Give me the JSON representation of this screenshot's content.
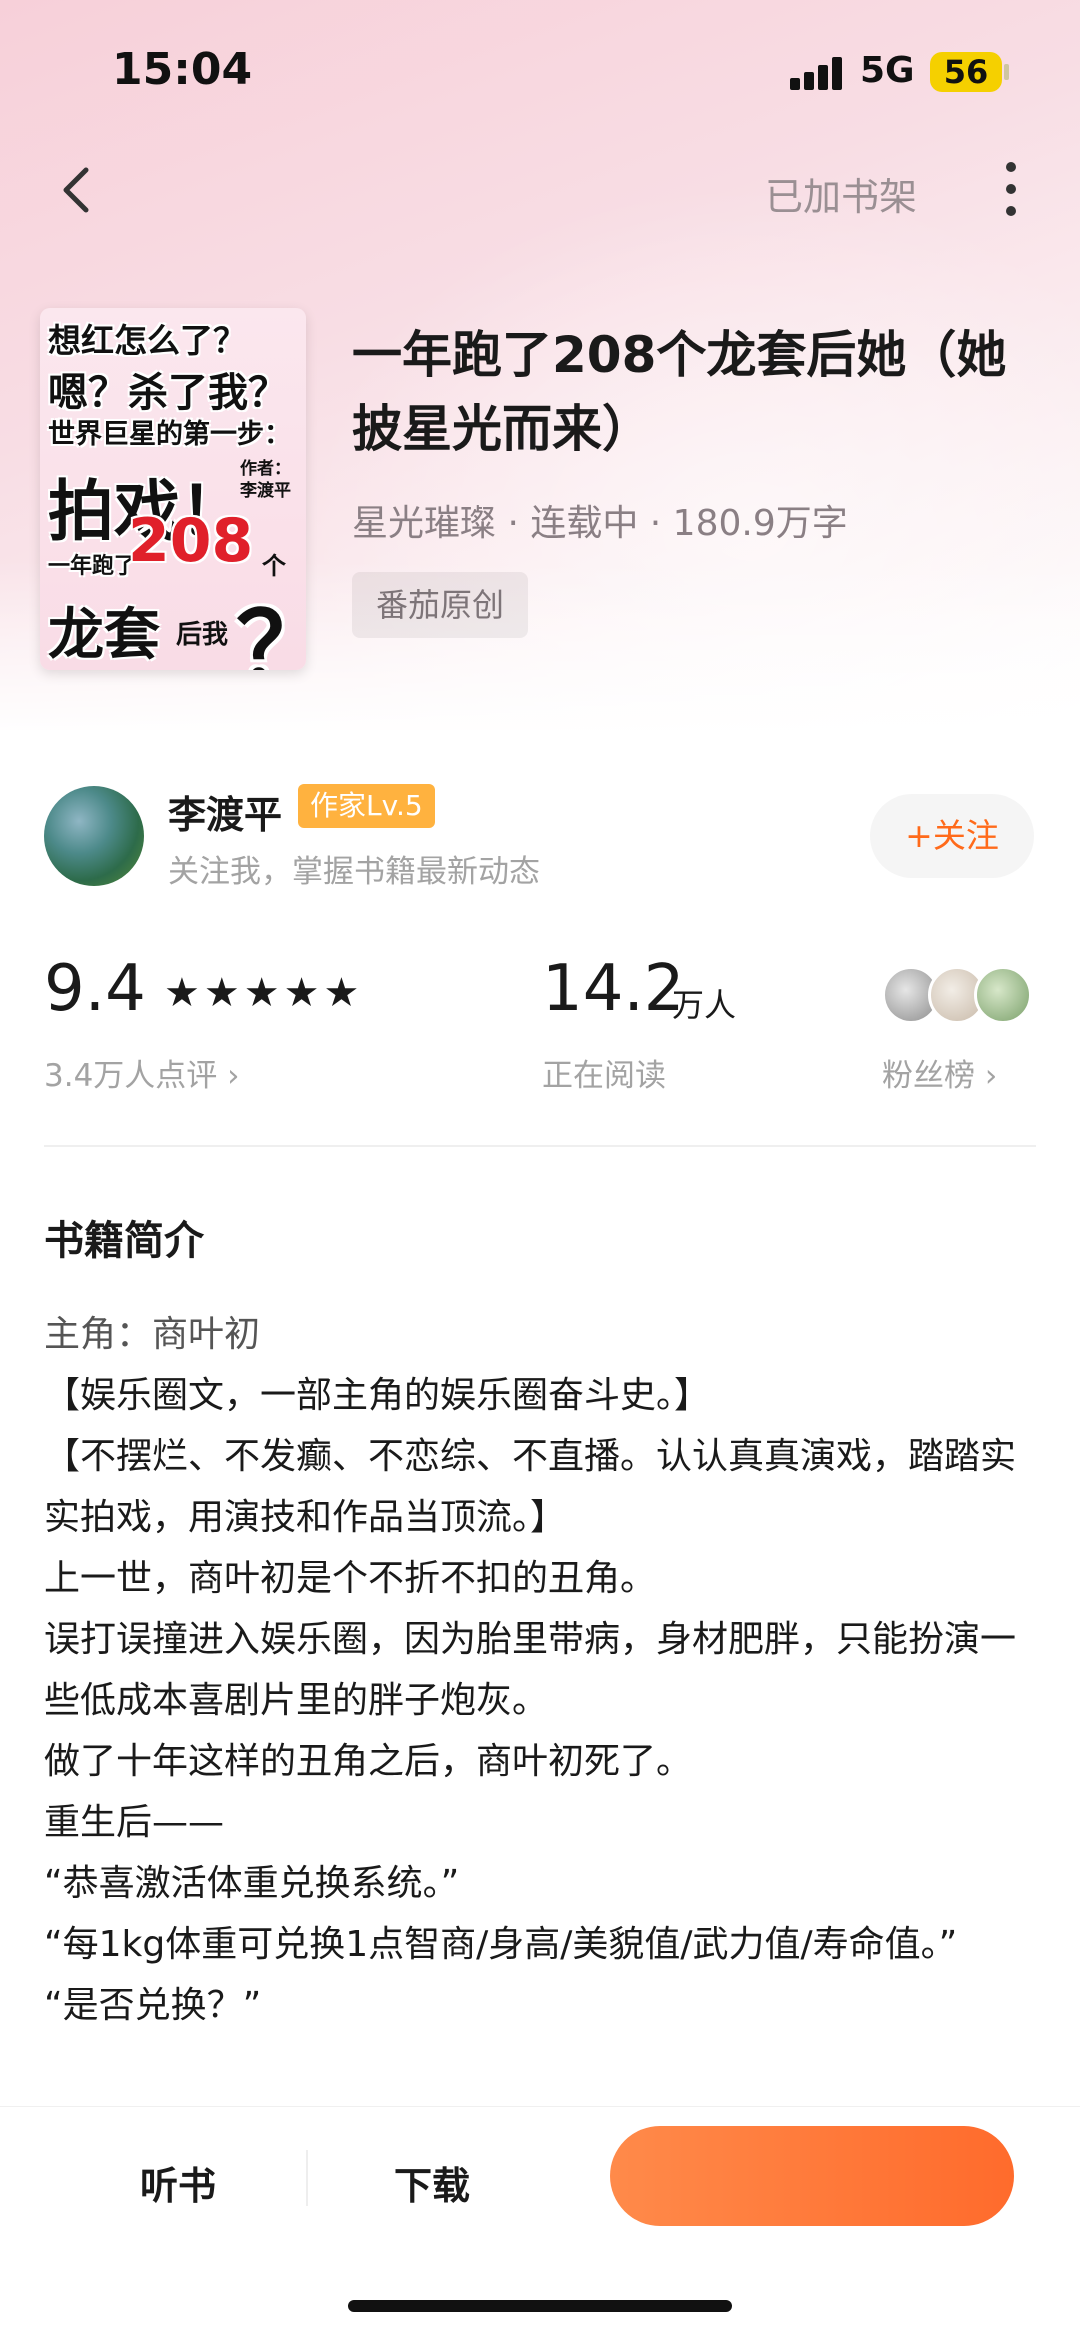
{
  "status": {
    "time": "15:04",
    "network": "5G",
    "battery": "56"
  },
  "nav": {
    "shelf_label": "已加书架"
  },
  "cover": {
    "line1": "想红怎么了？",
    "line2": "嗯？杀了我？",
    "line3": "世界巨星的第一步：",
    "line4": "拍戏！",
    "author_tag": "作者：\n李渡平",
    "line5": "一年跑了",
    "number": "208",
    "unit": "个",
    "line6": "龙套",
    "line6b": "后我",
    "question": "？"
  },
  "book": {
    "title": "一年跑了208个龙套后她（她披星光而来）",
    "meta": "星光璀璨 · 连载中 · 180.9万字",
    "tag": "番茄原创"
  },
  "author": {
    "name": "李渡平",
    "level": "作家Lv.5",
    "desc": "关注我，掌握书籍最新动态",
    "follow_label": "+关注"
  },
  "stats": {
    "score": "9.4",
    "stars": "★★★★★",
    "reviews": "3.4万人点评 ›",
    "reading_num": "14.2",
    "reading_unit": "万人",
    "reading_label": "正在阅读",
    "fans_label": "粉丝榜 ›"
  },
  "synopsis": {
    "heading": "书籍简介",
    "lines": [
      "主角：商叶初",
      "【娱乐圈文，一部主角的娱乐圈奋斗史。】",
      "【不摆烂、不发癫、不恋综、不直播。认认真真演戏，踏踏实实拍戏，用演技和作品当顶流。】",
      "上一世，商叶初是个不折不扣的丑角。",
      "误打误撞进入娱乐圈，因为胎里带病，身材肥胖，只能扮演一些低成本喜剧片里的胖子炮灰。",
      "做了十年这样的丑角之后，商叶初死了。",
      "重生后——",
      "“恭喜激活体重兑换系统。”",
      "“每1kg体重可兑换1点智商/身高/美貌值/武力值/寿命值。”",
      "“是否兑换？”"
    ]
  },
  "bottom": {
    "listen": "听书",
    "download": "下载"
  },
  "colors": {
    "accent": "#ff6b2c",
    "level_badge": "#ffb23f",
    "hero": "#f7d0d9"
  }
}
